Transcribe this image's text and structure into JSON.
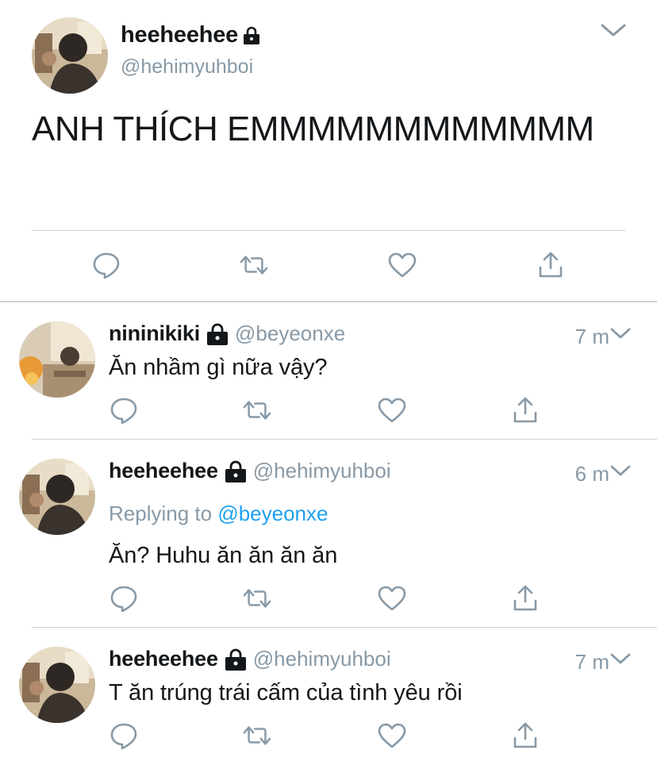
{
  "main_tweet": {
    "display_name": "heeheehee",
    "handle": "@hehimyuhboi",
    "text": "ANH THÍCH EMMMMMMMMMMMM",
    "protected": true
  },
  "replies": [
    {
      "display_name": "nininikiki",
      "handle": "@beyeonxe",
      "time": "7 m",
      "text": "Ăn nhầm gì nữa vậy?",
      "protected": true
    },
    {
      "display_name": "heeheehee",
      "handle": "@hehimyuhboi",
      "time": "6 m",
      "replying_prefix": "Replying to",
      "replying_to": "@beyeonxe",
      "text": "Ăn? Huhu ăn ăn ăn ăn",
      "protected": true
    },
    {
      "display_name": "heeheehee",
      "handle": "@hehimyuhboi",
      "time": "7 m",
      "text": "T ăn trúng trái cấm của tình yêu rồi",
      "protected": true
    }
  ],
  "icons": {
    "reply": "reply-icon",
    "retweet": "retweet-icon",
    "like": "heart-icon",
    "share": "share-icon",
    "lock": "lock-icon",
    "menu": "chevron-down-icon"
  },
  "colors": {
    "text": "#14171a",
    "secondary": "#8899a6",
    "link": "#1da1f2",
    "divider": "#ccd1d6"
  }
}
